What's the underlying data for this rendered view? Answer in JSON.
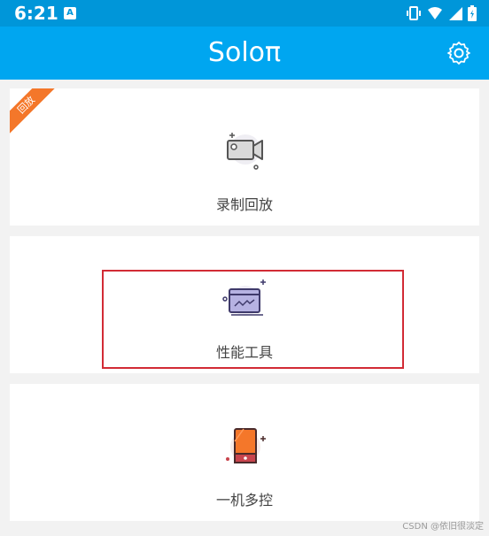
{
  "status_bar": {
    "time": "6:21",
    "notification_glyph": "A",
    "icons": [
      "vibrate-icon",
      "wifi-icon",
      "signal-icon",
      "battery-icon"
    ]
  },
  "app_bar": {
    "title": "Soloπ",
    "settings_icon": "gear-icon"
  },
  "cards": [
    {
      "label": "录制回放",
      "badge": "回放",
      "icon": "video-camera-icon"
    },
    {
      "label": "性能工具",
      "icon": "performance-window-icon"
    },
    {
      "label": "一机多控",
      "icon": "phone-icon"
    }
  ],
  "watermark": "CSDN @依旧很淡定",
  "colors": {
    "status_bar": "#0096d9",
    "app_bar": "#00a6f0",
    "background": "#f2f2f2",
    "badge": "#f4772a",
    "highlight": "#d22b35"
  }
}
